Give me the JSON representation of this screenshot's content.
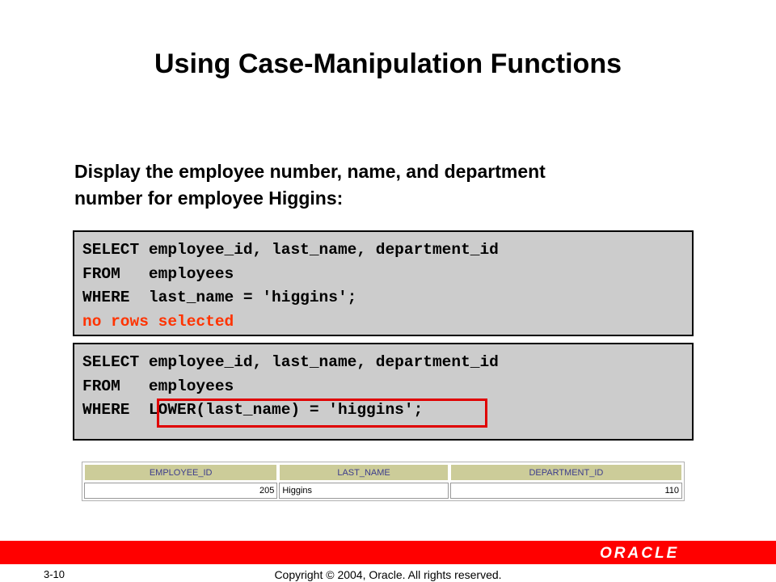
{
  "title": "Using Case-Manipulation Functions",
  "intro": {
    "line1": "Display the employee number, name, and department",
    "line2": "number for employee Higgins:"
  },
  "query1": {
    "line1": "SELECT employee_id, last_name, department_id",
    "line2": "FROM   employees",
    "line3": "WHERE  last_name = 'higgins';",
    "result": "no rows selected"
  },
  "query2": {
    "line1": "SELECT employee_id, last_name, department_id",
    "line2": "FROM   employees",
    "line3": "WHERE  LOWER(last_name) = 'higgins';"
  },
  "result_table": {
    "headers": [
      "EMPLOYEE_ID",
      "LAST_NAME",
      "DEPARTMENT_ID"
    ],
    "rows": [
      [
        "205",
        "Higgins",
        "110"
      ]
    ]
  },
  "footer": {
    "slide_number": "3-10",
    "copyright": "Copyright © 2004, Oracle.  All rights reserved.",
    "logo": "ORACLE"
  },
  "colors": {
    "footer_bar": "#ff0000",
    "code_background": "#cccccc",
    "error_text": "#ff3300",
    "highlight_border": "#e00000",
    "table_header_bg": "#cccc99",
    "table_header_text": "#3c3c8c"
  }
}
